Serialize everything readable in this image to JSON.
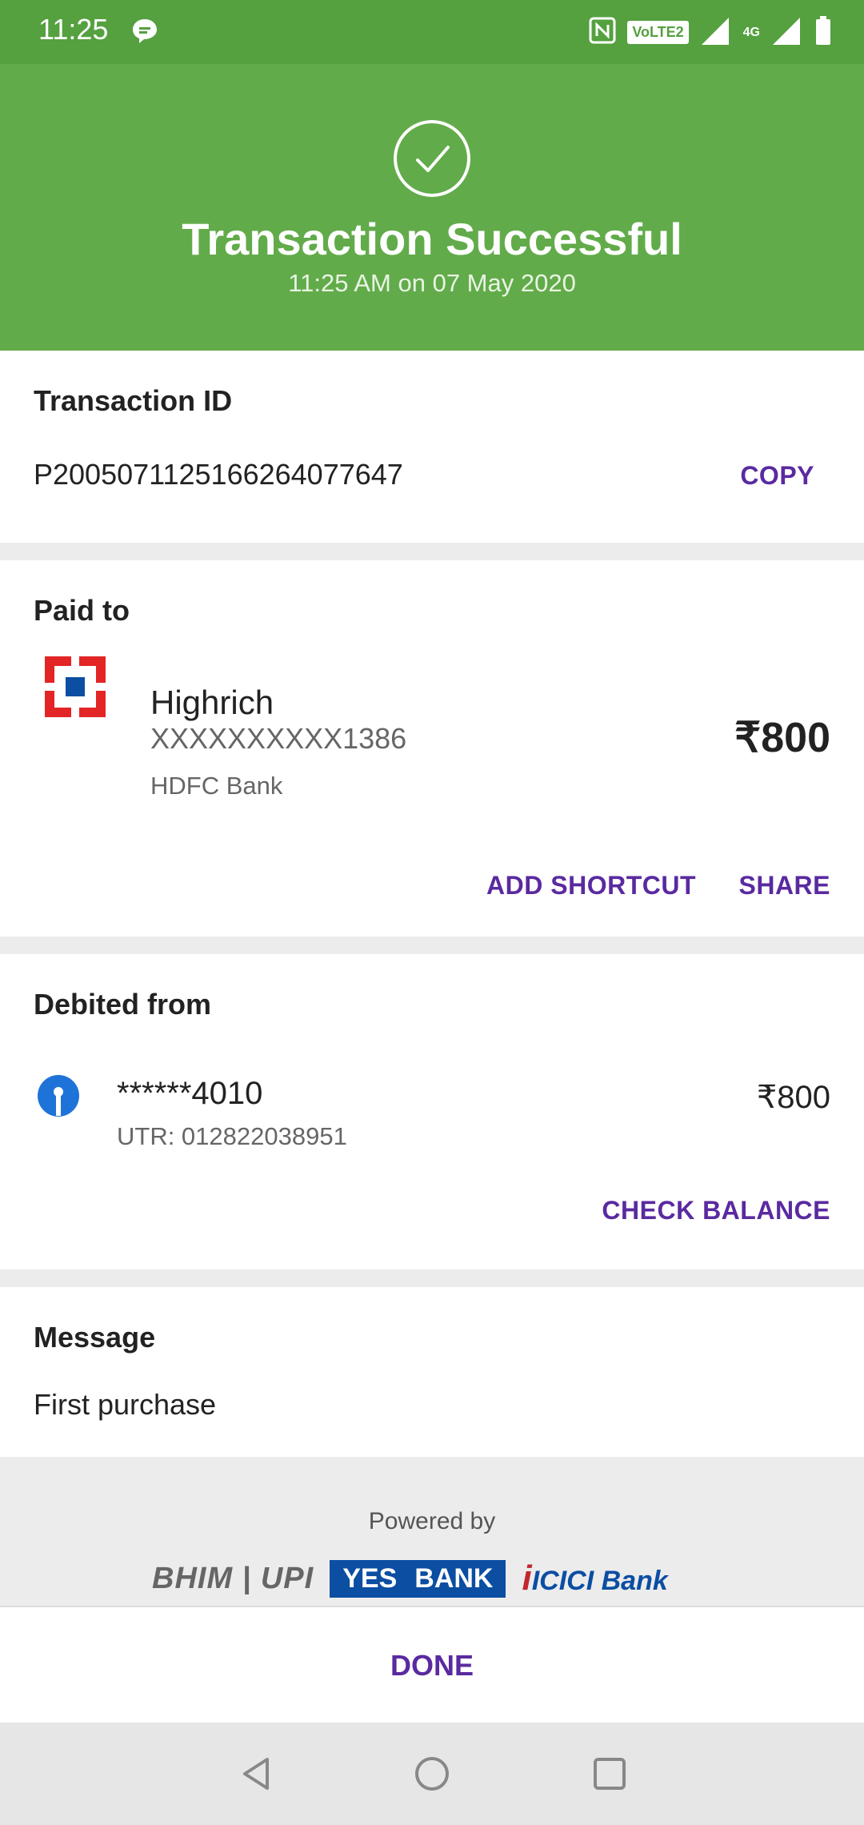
{
  "status_bar": {
    "time": "11:25",
    "volte_label": "VoLTE2",
    "network_label": "4G"
  },
  "header": {
    "title": "Transaction Successful",
    "subtitle": "11:25 AM on 07 May 2020"
  },
  "transaction": {
    "label": "Transaction ID",
    "id": "P2005071125166264077647",
    "copy_label": "COPY"
  },
  "paid_to": {
    "label": "Paid to",
    "name": "Highrich",
    "account": "XXXXXXXXXX1386",
    "bank": "HDFC Bank",
    "amount": "₹800",
    "add_shortcut_label": "ADD SHORTCUT",
    "share_label": "SHARE"
  },
  "debited_from": {
    "label": "Debited from",
    "account": "******4010",
    "utr": "UTR: 012822038951",
    "amount": "₹800",
    "check_balance_label": "CHECK BALANCE"
  },
  "message": {
    "label": "Message",
    "text": "First purchase"
  },
  "powered_by": {
    "label": "Powered by",
    "partners": [
      "BHIM",
      "UPI",
      "YES",
      "BANK",
      "ICICI Bank"
    ]
  },
  "footer": {
    "done_label": "DONE"
  },
  "colors": {
    "status_bar": "#55a03f",
    "header": "#62ab4a",
    "accent": "#5a2aa0"
  }
}
